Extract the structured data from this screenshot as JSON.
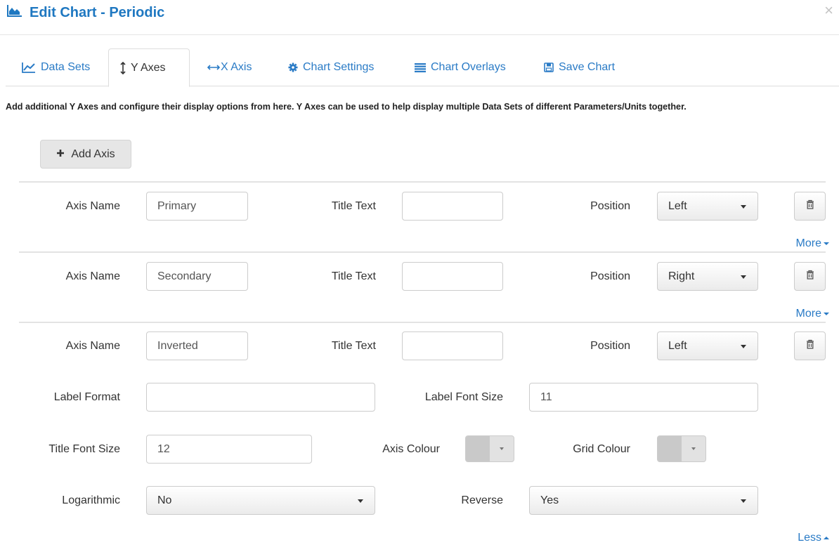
{
  "dialog": {
    "title": "Edit Chart - Periodic",
    "icon": "area-chart-icon",
    "close_symbol": "×"
  },
  "tabs": [
    {
      "label": "Data Sets",
      "icon": "line-chart-icon",
      "active": false
    },
    {
      "label": "Y Axes",
      "icon": "vertical-arrows-icon",
      "active": true
    },
    {
      "label": "X Axis",
      "icon": "horizontal-arrows-icon",
      "active": false
    },
    {
      "label": "Chart Settings",
      "icon": "gear-icon",
      "active": false
    },
    {
      "label": "Chart Overlays",
      "icon": "list-icon",
      "active": false
    },
    {
      "label": "Save Chart",
      "icon": "floppy-disk-icon",
      "active": false
    }
  ],
  "description": "Add additional Y Axes and configure their display options from here. Y Axes can be used to help display multiple Data Sets of different Parameters/Units together.",
  "add_axis_label": "Add Axis",
  "labels": {
    "axis_name": "Axis Name",
    "title_text": "Title Text",
    "position": "Position",
    "label_format": "Label Format",
    "label_font_size": "Label Font Size",
    "title_font_size": "Title Font Size",
    "axis_colour": "Axis Colour",
    "grid_colour": "Grid Colour",
    "logarithmic": "Logarithmic",
    "reverse": "Reverse",
    "more": "More",
    "less": "Less"
  },
  "axes": [
    {
      "name": "Primary",
      "title_text": "",
      "position": "Left",
      "expanded": false
    },
    {
      "name": "Secondary",
      "title_text": "",
      "position": "Right",
      "expanded": false
    },
    {
      "name": "Inverted",
      "title_text": "",
      "position": "Left",
      "expanded": true,
      "label_format": "",
      "label_font_size": "11",
      "title_font_size": "12",
      "axis_colour": "#c9c9c9",
      "grid_colour": "#c9c9c9",
      "logarithmic": "No",
      "reverse": "Yes"
    }
  ],
  "colors": {
    "accent": "#1f78c1",
    "link": "#2a7bc6"
  }
}
